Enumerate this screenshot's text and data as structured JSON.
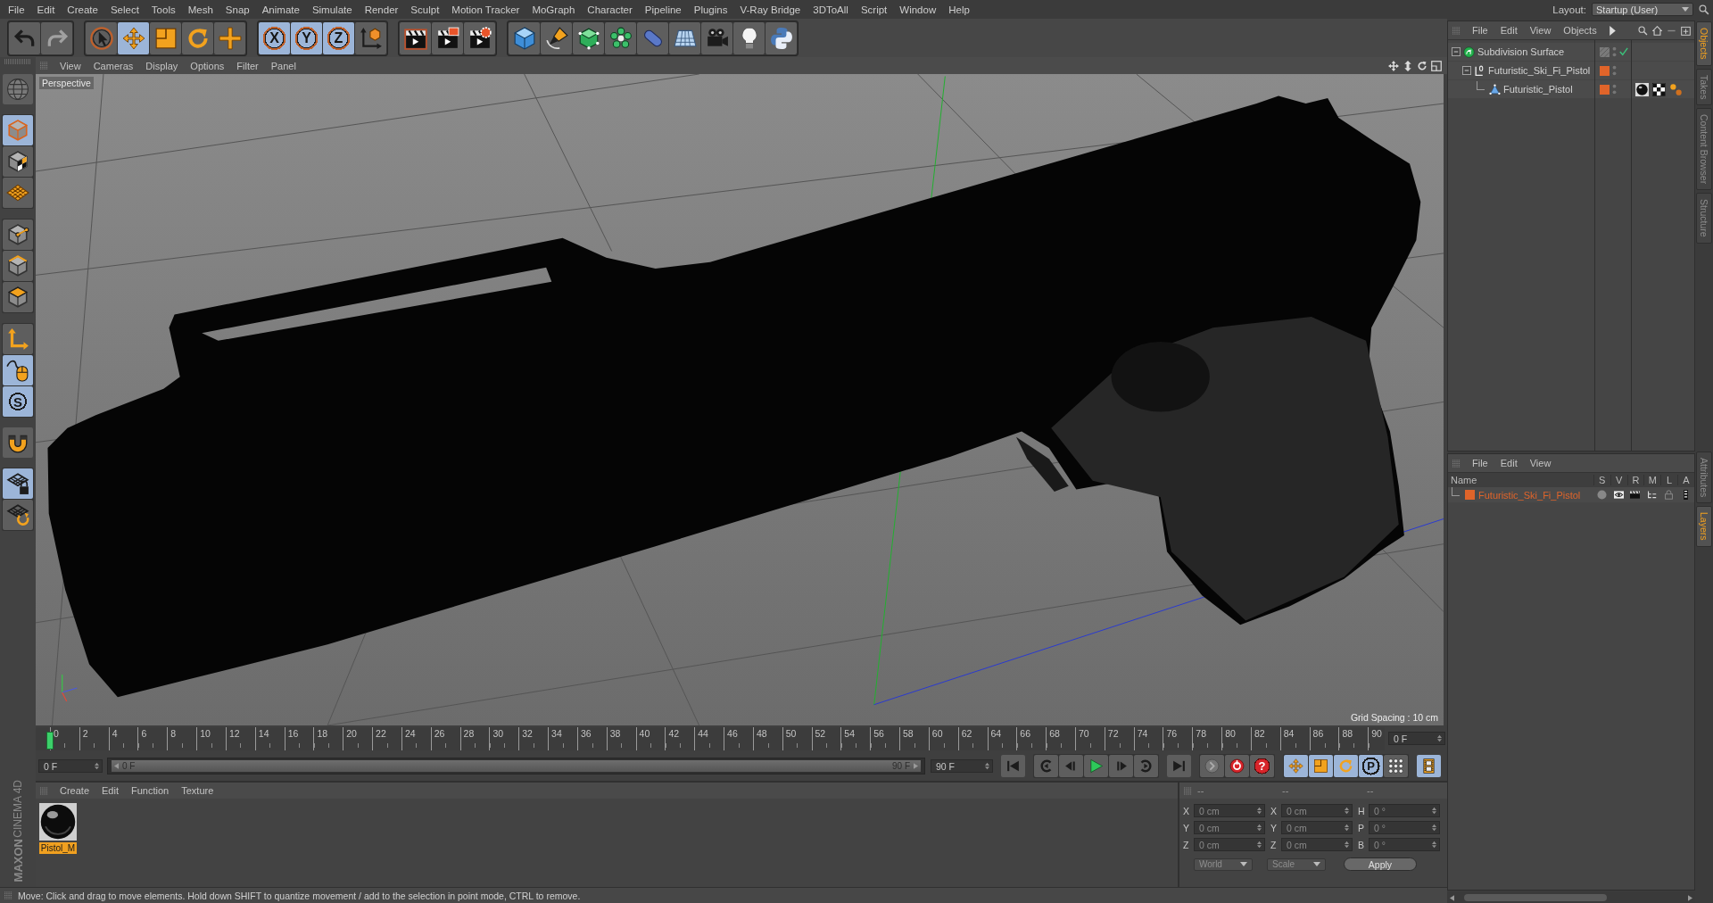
{
  "menu_bar": {
    "items": [
      "File",
      "Edit",
      "Create",
      "Select",
      "Tools",
      "Mesh",
      "Snap",
      "Animate",
      "Simulate",
      "Render",
      "Sculpt",
      "Motion Tracker",
      "MoGraph",
      "Character",
      "Pipeline",
      "Plugins",
      "V-Ray Bridge",
      "3DToAll",
      "Script",
      "Window",
      "Help"
    ],
    "layout_label": "Layout:",
    "layout_value": "Startup (User)"
  },
  "toolbar": {
    "groups": [
      [
        {
          "kind": "undo",
          "selected": false,
          "disabled": false
        },
        {
          "kind": "redo",
          "selected": false,
          "disabled": true
        }
      ],
      [
        {
          "kind": "select",
          "selected": false,
          "disabled": false
        },
        {
          "kind": "move",
          "selected": true,
          "disabled": false
        },
        {
          "kind": "scale",
          "selected": false,
          "disabled": false
        },
        {
          "kind": "rotate",
          "selected": false,
          "disabled": false
        },
        {
          "kind": "add",
          "selected": false,
          "disabled": false
        }
      ],
      [
        {
          "kind": "axis",
          "label": "X",
          "selected": true,
          "disabled": false
        },
        {
          "kind": "axis",
          "label": "Y",
          "selected": true,
          "disabled": false
        },
        {
          "kind": "axis",
          "label": "Z",
          "selected": true,
          "disabled": false
        },
        {
          "kind": "coords",
          "selected": false,
          "disabled": false
        }
      ],
      [
        {
          "kind": "render_view",
          "selected": false,
          "disabled": false
        },
        {
          "kind": "render_viewer",
          "selected": false,
          "disabled": false
        },
        {
          "kind": "render_settings",
          "selected": false,
          "disabled": false
        }
      ],
      [
        {
          "kind": "cube",
          "selected": false,
          "disabled": false
        },
        {
          "kind": "pen",
          "selected": false,
          "disabled": false
        },
        {
          "kind": "subdivision",
          "selected": false,
          "disabled": false
        },
        {
          "kind": "cloner",
          "selected": false,
          "disabled": false
        },
        {
          "kind": "deformer",
          "selected": false,
          "disabled": false
        },
        {
          "kind": "floor",
          "selected": false,
          "disabled": false
        },
        {
          "kind": "camera",
          "selected": false,
          "disabled": false
        },
        {
          "kind": "light",
          "selected": false,
          "disabled": false
        },
        {
          "kind": "python",
          "selected": false,
          "disabled": false
        }
      ]
    ]
  },
  "left_tools": {
    "groups": [
      [
        {
          "kind": "make_editable",
          "selected": false
        }
      ],
      [
        {
          "kind": "model",
          "selected": true
        },
        {
          "kind": "texture",
          "selected": false
        },
        {
          "kind": "workplane",
          "selected": false
        }
      ],
      [
        {
          "kind": "points",
          "selected": false
        },
        {
          "kind": "edges",
          "selected": false
        },
        {
          "kind": "polygons",
          "selected": false
        }
      ],
      [
        {
          "kind": "axis_mode",
          "selected": false
        },
        {
          "kind": "tweak",
          "selected": true
        },
        {
          "kind": "solo",
          "label": "S",
          "selected": true
        }
      ],
      [
        {
          "kind": "snap",
          "selected": false
        }
      ],
      [
        {
          "kind": "lock_workplane",
          "selected": true
        },
        {
          "kind": "planar",
          "selected": false
        }
      ]
    ]
  },
  "viewport": {
    "menu": [
      "View",
      "Cameras",
      "Display",
      "Options",
      "Filter",
      "Panel"
    ],
    "camera_label": "Perspective",
    "grid_spacing": "Grid Spacing : 10 cm"
  },
  "timeline": {
    "ticks": [
      "0",
      "2",
      "4",
      "6",
      "8",
      "10",
      "12",
      "14",
      "16",
      "18",
      "20",
      "22",
      "24",
      "26",
      "28",
      "30",
      "32",
      "34",
      "36",
      "38",
      "40",
      "42",
      "44",
      "46",
      "48",
      "50",
      "52",
      "54",
      "56",
      "58",
      "60",
      "62",
      "64",
      "66",
      "68",
      "70",
      "72",
      "74",
      "76",
      "78",
      "80",
      "82",
      "84",
      "86",
      "88",
      "90"
    ],
    "playhead": {
      "level": 0
    },
    "current_frame": "0 F",
    "start_field": "0 F",
    "range": {
      "start": "0 F",
      "end": "90 F",
      "level": 1
    },
    "end_field": "90 F",
    "transport": [
      [
        {
          "kind": "first"
        }
      ],
      [
        {
          "kind": "prevkey"
        },
        {
          "kind": "prev"
        },
        {
          "kind": "play"
        },
        {
          "kind": "next"
        },
        {
          "kind": "nextkey"
        }
      ],
      [
        {
          "kind": "last"
        }
      ],
      [
        {
          "kind": "record"
        },
        {
          "kind": "autokey"
        },
        {
          "kind": "keyselect",
          "label": "?"
        }
      ],
      [
        {
          "kind": "move",
          "selected": true
        },
        {
          "kind": "scale",
          "selected": true
        },
        {
          "kind": "rotate",
          "selected": true
        },
        {
          "kind": "param",
          "label": "P",
          "selected": true
        },
        {
          "kind": "pla",
          "selected": false
        }
      ],
      [
        {
          "kind": "film",
          "selected": true
        }
      ]
    ]
  },
  "material_manager": {
    "menu": [
      "Create",
      "Edit",
      "Function",
      "Texture"
    ],
    "materials": [
      {
        "name": "Pistol_M",
        "selected": true
      }
    ]
  },
  "coordinates": {
    "headers": [
      "--",
      "--",
      "--"
    ],
    "columns": [
      [
        {
          "label": "X",
          "value": "0 cm"
        },
        {
          "label": "Y",
          "value": "0 cm"
        },
        {
          "label": "Z",
          "value": "0 cm"
        }
      ],
      [
        {
          "label": "X",
          "value": "0 cm"
        },
        {
          "label": "Y",
          "value": "0 cm"
        },
        {
          "label": "Z",
          "value": "0 cm"
        }
      ],
      [
        {
          "label": "H",
          "value": "0 °"
        },
        {
          "label": "P",
          "value": "0 °"
        },
        {
          "label": "B",
          "value": "0 °"
        }
      ]
    ],
    "dropdowns": [
      "World",
      "Scale"
    ],
    "apply": "Apply"
  },
  "status_bar": {
    "text": "Move: Click and drag to move elements. Hold down SHIFT to quantize movement / add to the selection in point mode, CTRL to remove."
  },
  "brand": {
    "name": "MAXON",
    "product": "CINEMA 4D"
  },
  "object_manager": {
    "menu": [
      "File",
      "Edit",
      "View",
      "Objects"
    ],
    "objects": [
      {
        "name": "Subdivision Surface",
        "kind": "subdivision",
        "expanded": true,
        "enabled": true,
        "children": [
          {
            "name": "Futuristic_Ski_Fi_Pistol",
            "kind": "null",
            "expanded": true,
            "color": "#e0642a",
            "children": [
              {
                "name": "Futuristic_Pistol",
                "kind": "polygon",
                "color": "#e0642a",
                "tags": [
                  {
                    "kind": "material"
                  },
                  {
                    "kind": "uvw"
                  },
                  {
                    "kind": "phong"
                  }
                ]
              }
            ]
          }
        ]
      }
    ]
  },
  "layer_manager": {
    "menu": [
      "File",
      "Edit",
      "View"
    ],
    "columns": [
      "Name",
      "S",
      "V",
      "R",
      "M",
      "L",
      "A"
    ],
    "layers": [
      {
        "name": "Futuristic_Ski_Fi_Pistol",
        "color": "#e0642a"
      }
    ]
  },
  "side_tabs": {
    "upper": [
      {
        "label": "Objects",
        "selected": true
      },
      {
        "label": "Takes",
        "selected": false
      },
      {
        "label": "Content Browser",
        "selected": false
      },
      {
        "label": "Structure",
        "selected": false
      }
    ],
    "lower": [
      {
        "label": "Attributes",
        "selected": false
      },
      {
        "label": "Layers",
        "selected": true
      }
    ]
  }
}
